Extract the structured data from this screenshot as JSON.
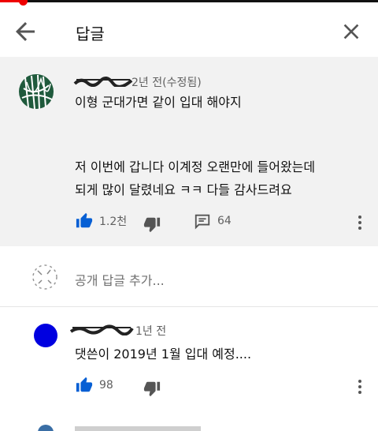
{
  "video_progress": {
    "fraction": 0.06,
    "colors": {
      "played": "#e00000",
      "track": "#111111"
    }
  },
  "header": {
    "title": "답글",
    "back_icon": "arrow-left-icon",
    "close_icon": "close-icon"
  },
  "main_comment": {
    "meta": "2년 전(수정됨)",
    "lines": [
      "이형 군대가면 같이 입대 해야지",
      "저  이번에  갑니다  이계정 오랜만에 들어왔는데",
      "되게 많이 달렸네요 ㅋㅋ 다들 감사드려요"
    ],
    "like_count": "1.2천",
    "reply_count": "64",
    "icons": {
      "like": "thumbs-up-icon",
      "dislike": "thumbs-down-icon",
      "reply": "comment-icon",
      "more": "more-vert-icon"
    }
  },
  "add_reply": {
    "placeholder": "공개 답글 추가..."
  },
  "replies": [
    {
      "meta": "1년 전",
      "text": "댓쓴이 2019년 1월 입대 예정....",
      "like_count": "98",
      "avatar_color": "#0000e0"
    }
  ],
  "colors": {
    "accent": "#065fd4",
    "highlight_bg": "#f2f2f2",
    "meta_text": "#606060"
  }
}
